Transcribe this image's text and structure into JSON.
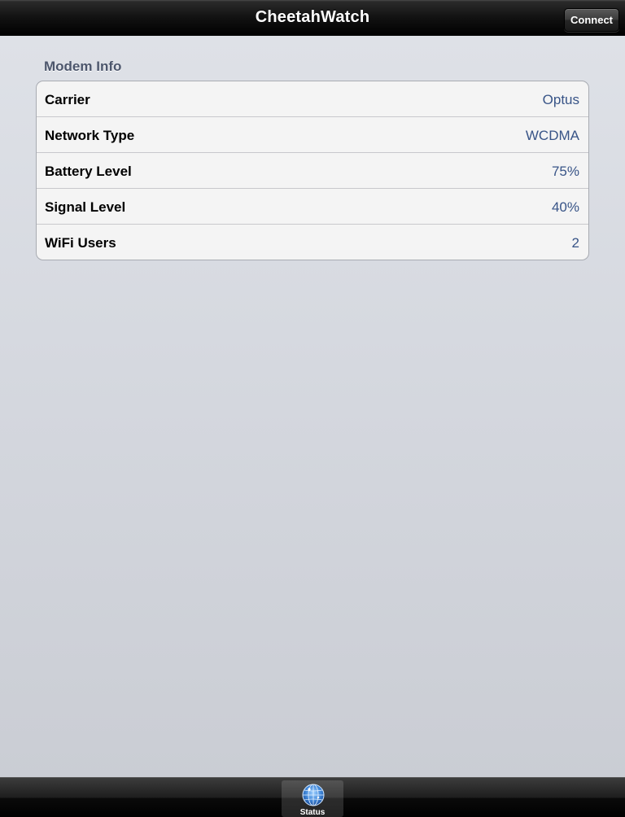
{
  "navbar": {
    "title": "CheetahWatch",
    "connect_label": "Connect"
  },
  "section": {
    "header": "Modem Info",
    "rows": [
      {
        "label": "Carrier",
        "value": "Optus"
      },
      {
        "label": "Network Type",
        "value": "WCDMA"
      },
      {
        "label": "Battery Level",
        "value": "75%"
      },
      {
        "label": "Signal Level",
        "value": "40%"
      },
      {
        "label": "WiFi Users",
        "value": "2"
      }
    ]
  },
  "tabbar": {
    "items": [
      {
        "label": "Status",
        "icon": "radar-globe-icon",
        "selected": true
      }
    ]
  },
  "colors": {
    "value_text": "#385487",
    "section_header": "#4c566c",
    "tab_icon_accent": "#4a8fe0"
  }
}
